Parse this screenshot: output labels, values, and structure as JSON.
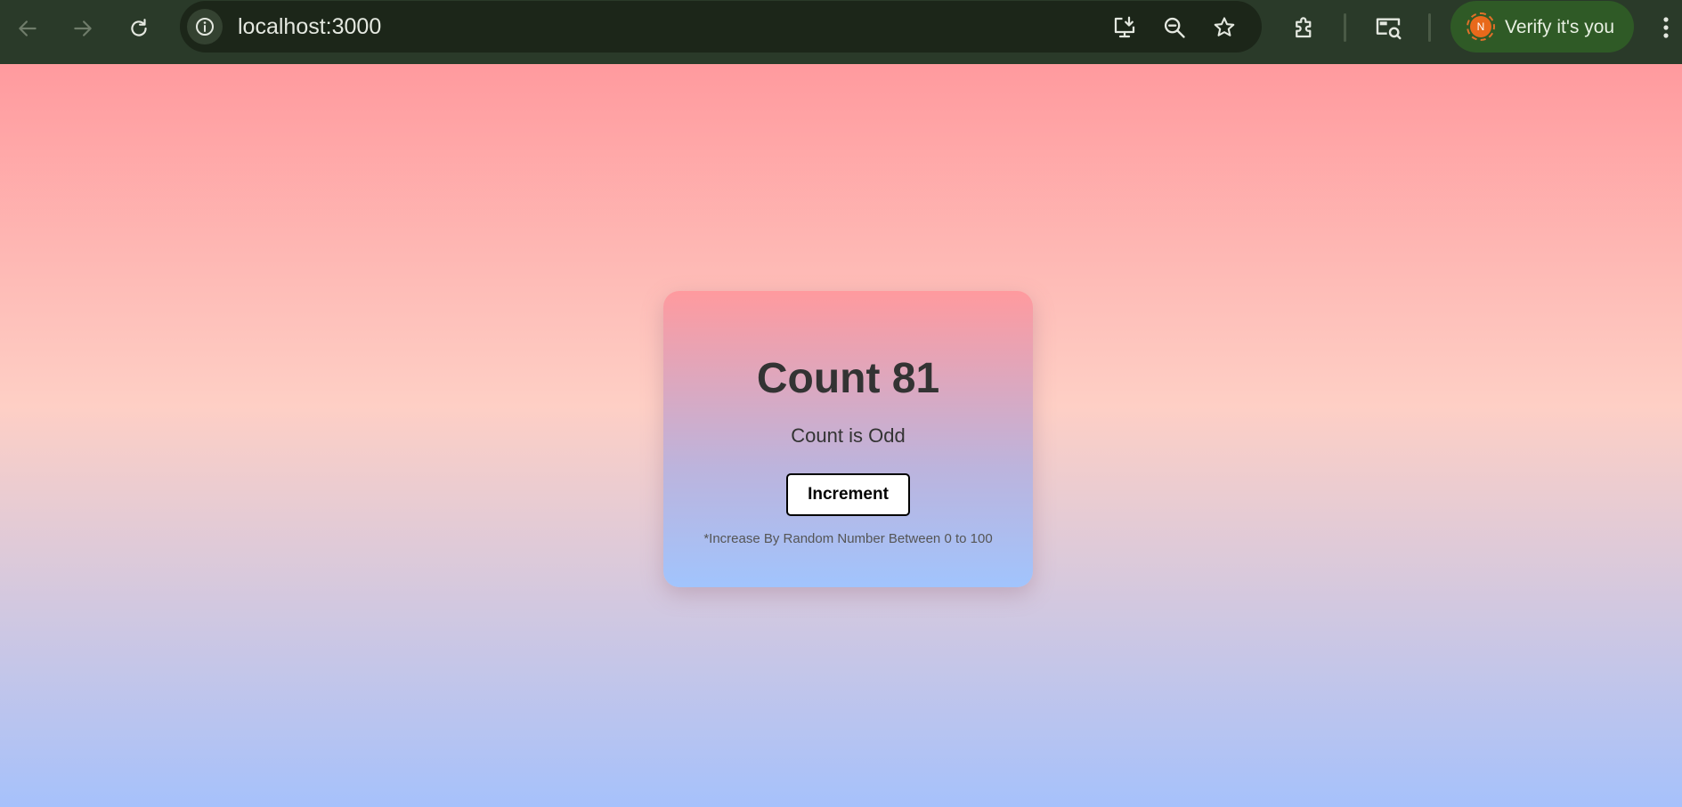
{
  "browser": {
    "url": "localhost:3000",
    "verify_label": "Verify it's you",
    "avatar_initial": "N",
    "icons": {
      "back": "arrow-left-icon",
      "forward": "arrow-right-icon",
      "reload": "reload-icon",
      "site_info": "info-icon",
      "install": "install-app-icon",
      "zoom": "zoom-out-icon",
      "bookmark": "star-icon",
      "extensions": "puzzle-icon",
      "lens": "search-screen-icon",
      "menu": "kebab-menu-icon"
    }
  },
  "counter": {
    "title": "Count 81",
    "parity": "Count is Odd",
    "button_label": "Increment",
    "note": "*Increase By Random Number Between 0 to 100"
  },
  "colors": {
    "toolbar": "#2a3a29",
    "omnibox": "#1c2619",
    "verify_chip": "#2f5a26",
    "avatar": "#e8691b",
    "page_gradient": [
      "#ff9a9e",
      "#fecfc5",
      "#a6c1fb"
    ],
    "card_gradient": [
      "#ff9a9e",
      "#a1c4fd"
    ]
  }
}
